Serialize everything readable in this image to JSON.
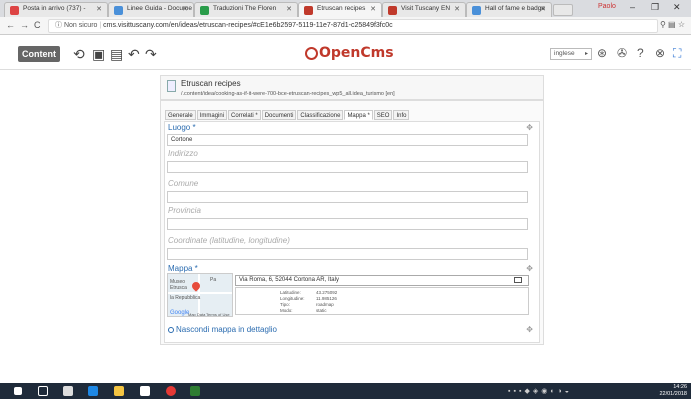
{
  "browser": {
    "tabs": [
      {
        "label": "Posta in arrivo (737) - ",
        "color": "#d44"
      },
      {
        "label": "Linee Guida - Docume",
        "color": "#4a90d9"
      },
      {
        "label": "Traduzioni The Floren",
        "color": "#2a9d4b"
      },
      {
        "label": "Etruscan recipes",
        "color": "#c0392b"
      },
      {
        "label": "Visit Tuscany EN",
        "color": "#c0392b"
      },
      {
        "label": "Hall of fame e badge",
        "color": "#4a90d9"
      }
    ],
    "profile": "Paolo",
    "insecure_label": "Non sicuro",
    "url": "cms.visittuscany.com/en/ideas/etruscan-recipes/#cE1e6b2597-5119-11e7-87d1-c25849f3fc0c"
  },
  "toolbar": {
    "content_label": "Content",
    "logo": "OpenCms",
    "language": "inglese"
  },
  "resource": {
    "title": "Etruscan recipes",
    "path": "/.content/idea/cooking-as-if-it-were-700-bce-etruscan-recipes_wp5_all.idea_turismo [en]"
  },
  "tabs": [
    "Generale",
    "Immagini",
    "Correlati *",
    "Documenti",
    "Classificazione",
    "Mappa *",
    "SEO",
    "Info"
  ],
  "fields": {
    "luogo_label": "Luogo *",
    "luogo_value": "Cortone",
    "indirizzo_label": "Indirizzo",
    "comune_label": "Comune",
    "provincia_label": "Provincia",
    "coordinate_label": "Coordinate (latitudine, longitudine)",
    "mappa_label": "Mappa *",
    "map_address": "Via Roma, 6, 52044 Cortona AR, Italy",
    "hide_map_label": "Nascondi mappa in dettaglio"
  },
  "map_info": {
    "keys": [
      "Latitudine:",
      "Longitudine:",
      "Tipo:",
      "Modo:"
    ],
    "values": [
      "43.275092",
      "11.985126",
      "roadmap",
      "static"
    ],
    "places": [
      "Museo",
      "Etrusca",
      "la Repubblica",
      "Pa",
      "Google",
      "Map Data",
      "Terms of Use"
    ]
  },
  "taskbar": {
    "time": "14:26",
    "date": "22/01/2018"
  }
}
